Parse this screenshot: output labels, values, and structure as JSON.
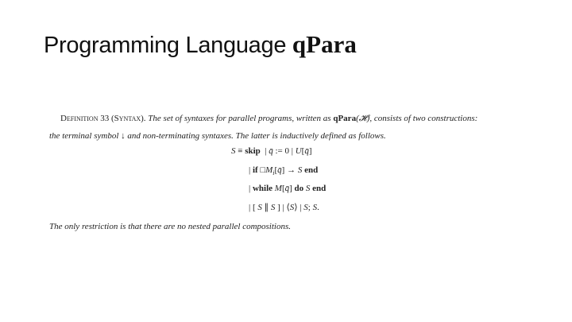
{
  "slide": {
    "title_prefix": "Programming Language ",
    "title_lang": "qPara"
  },
  "definition": {
    "label": "Definition 33 (Syntax).",
    "line1_text": "The set of syntaxes for parallel programs, written as",
    "lang_name": "qPara",
    "lang_arg": "(𝓗)",
    "line1_tail": ", consists of two constructions:",
    "line2_text": "the terminal symbol ↓ and non-terminating syntaxes. The latter is inductively defined as follows."
  },
  "grammar": {
    "row1": "S ≡ skip  | q̄ := 0 | U[q̄]",
    "row2": "| if □Mᵢ[q̄] → S end",
    "row3": "| while M[q̄] do S end",
    "row4": "| [ S ∥ S ] | ⟨S⟩ | S; S."
  },
  "closing": "The only restriction is that there are no nested parallel compositions."
}
